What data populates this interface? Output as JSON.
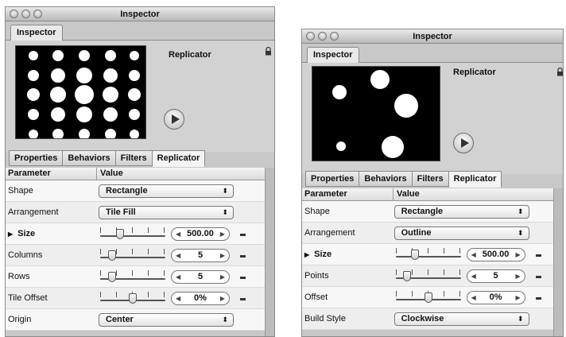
{
  "colors": {
    "window_bg": "#c8c8c8",
    "preview_bg": "#000000",
    "dot": "#ffffff",
    "table_bg": "#f7f7f7"
  },
  "windows": [
    {
      "title": "Inspector",
      "top_tab": "Inspector",
      "object_name": "Replicator",
      "icons": [
        "lock-icon",
        "play-icon"
      ],
      "tabs": [
        "Properties",
        "Behaviors",
        "Filters",
        "Replicator"
      ],
      "active_tab": "Replicator",
      "table_headers": [
        "Parameter",
        "Value"
      ],
      "rows": [
        {
          "label": "Shape",
          "type": "popup",
          "value": "Rectangle"
        },
        {
          "label": "Arrangement",
          "type": "popup",
          "value": "Tile Fill"
        },
        {
          "label": "Size",
          "type": "slider",
          "value": "500.00",
          "disclosure": "▶",
          "level": 0.3
        },
        {
          "label": "Columns",
          "type": "slider",
          "value": "5",
          "level": 0.18
        },
        {
          "label": "Rows",
          "type": "slider",
          "value": "5",
          "level": 0.18
        },
        {
          "label": "Tile Offset",
          "type": "slider",
          "value": "0%",
          "level": 0.5
        },
        {
          "label": "Origin",
          "type": "popup",
          "value": "Center"
        }
      ]
    },
    {
      "title": "Inspector",
      "top_tab": "Inspector",
      "object_name": "Replicator",
      "icons": [
        "lock-icon",
        "play-icon"
      ],
      "tabs": [
        "Properties",
        "Behaviors",
        "Filters",
        "Replicator"
      ],
      "active_tab": "Replicator",
      "table_headers": [
        "Parameter",
        "Value"
      ],
      "rows": [
        {
          "label": "Shape",
          "type": "popup",
          "value": "Rectangle"
        },
        {
          "label": "Arrangement",
          "type": "popup",
          "value": "Outline"
        },
        {
          "label": "Size",
          "type": "slider",
          "value": "500.00",
          "disclosure": "▶",
          "level": 0.3
        },
        {
          "label": "Points",
          "type": "slider",
          "value": "5",
          "level": 0.18
        },
        {
          "label": "Offset",
          "type": "slider",
          "value": "0%",
          "level": 0.5
        },
        {
          "label": "Build Style",
          "type": "popup",
          "value": "Clockwise"
        }
      ]
    }
  ]
}
